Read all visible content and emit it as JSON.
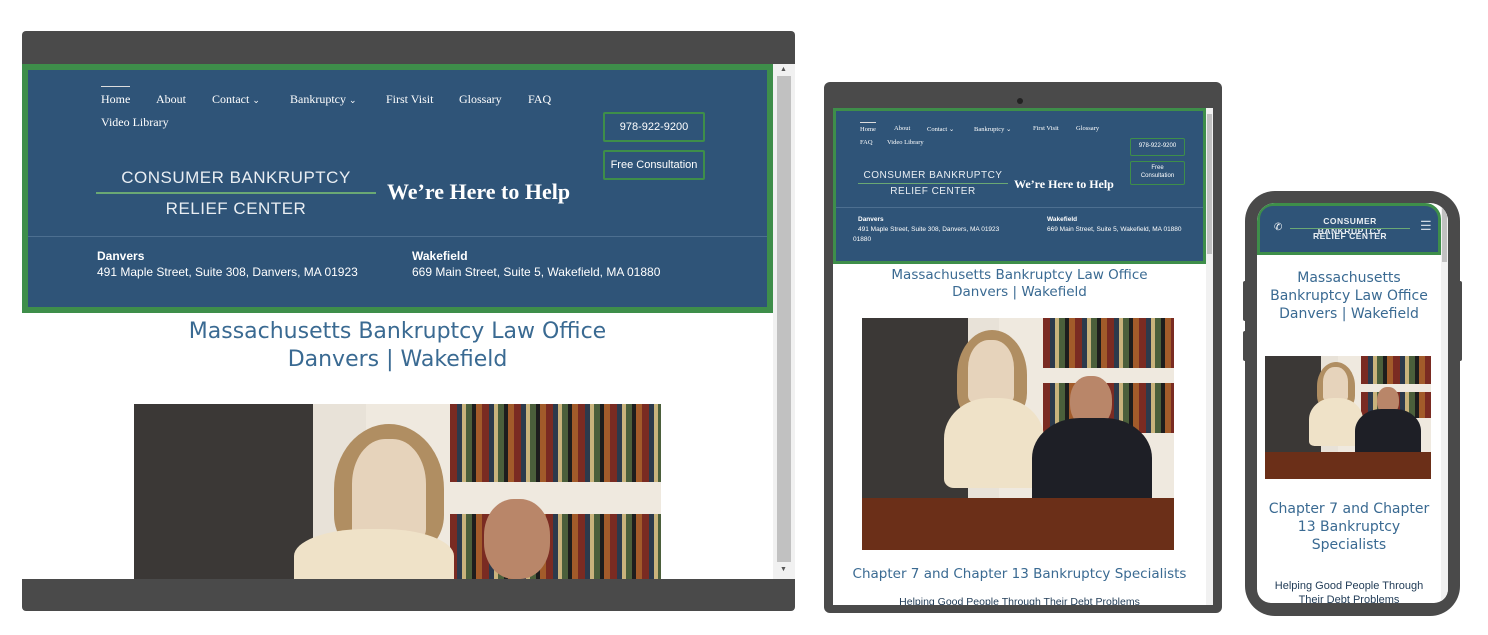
{
  "nav": {
    "home": "Home",
    "about": "About",
    "contact": "Contact",
    "bankruptcy": "Bankruptcy",
    "first_visit": "First Visit",
    "glossary": "Glossary",
    "faq": "FAQ",
    "video_library": "Video Library"
  },
  "buttons": {
    "phone": "978-922-9200",
    "consultation": "Free Consultation",
    "tablet_consultation_1": "Free",
    "tablet_consultation_2": "Consultation"
  },
  "logo": {
    "line1": "CONSUMER BANKRUPTCY",
    "line2": "RELIEF CENTER",
    "tagline": "We’re Here to Help"
  },
  "offices": {
    "danvers": {
      "name": "Danvers",
      "address": "491 Maple Street, Suite 308, Danvers, MA 01923"
    },
    "wakefield": {
      "name": "Wakefield",
      "address": "669 Main Street, Suite 5, Wakefield, MA 01880"
    },
    "danvers_address_tablet_1": "491 Maple Street, Suite 308, Danvers, MA 01923",
    "danvers_address_tablet_2": "01880"
  },
  "content": {
    "heading1": "Massachusetts Bankruptcy Law Office",
    "heading2": "Danvers | Wakefield",
    "phone_heading1": "Massachusetts",
    "phone_heading2": "Bankruptcy Law Office",
    "phone_heading3": "Danvers | Wakefield",
    "specialists": "Chapter 7 and Chapter 13 Bankruptcy Specialists",
    "phone_specialists1": "Chapter 7 and Chapter",
    "phone_specialists2": "13 Bankruptcy",
    "phone_specialists3": "Specialists",
    "helping": "Helping Good People Through Their Debt Problems",
    "phone_helping1": "Helping Good People Through",
    "phone_helping2": "Their Debt Problems"
  },
  "colors": {
    "header_bg": "#2f5478",
    "accent_green": "#3e8e4a",
    "heading_blue": "#3a6a92",
    "device_frame": "#4a4a4a"
  }
}
